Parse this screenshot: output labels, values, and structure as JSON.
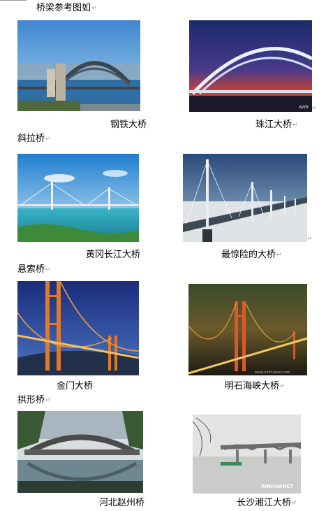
{
  "title": "桥梁参考图如",
  "paragraph_mark": "↵",
  "sections": [
    {
      "heading": ""
    },
    {
      "heading": "斜拉桥"
    },
    {
      "heading": "悬索桥"
    },
    {
      "heading": "拱形桥"
    }
  ],
  "captions": [
    "钢铁大桥",
    "珠江大桥",
    "黄冈长江大桥",
    "最惊险的大桥",
    "金门大桥",
    "明石海峡大桥",
    "河北赵州桥",
    "长沙湘江大桥"
  ],
  "watermarks": {
    "zhujiang": "AWB",
    "xiangjiang": "XINHUANET",
    "mingshi": "www.xinhuanet.com"
  }
}
